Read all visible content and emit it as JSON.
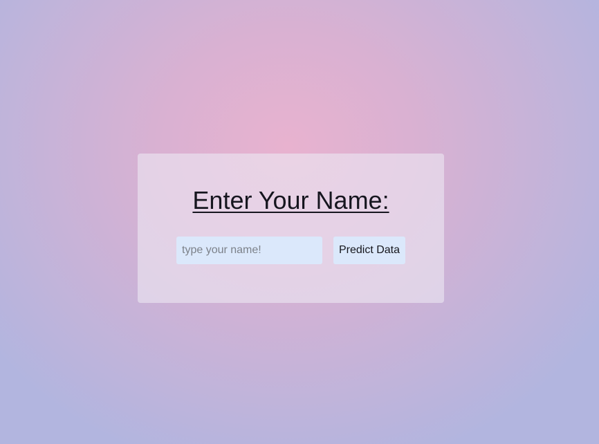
{
  "form": {
    "heading": "Enter Your Name:",
    "name_input": {
      "value": "",
      "placeholder": "type your name!"
    },
    "predict_label": "Predict Data"
  },
  "colors": {
    "background_center": "#e8b2cf",
    "background_edge": "#b2b5df",
    "card": "#e6dcec",
    "field": "#dbe8fb",
    "text": "#16161f"
  }
}
